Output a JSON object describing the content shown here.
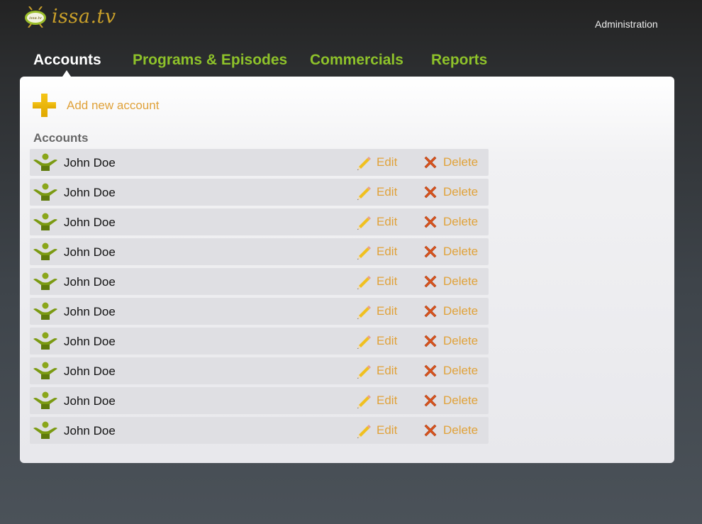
{
  "brand": {
    "name": "issa.tv",
    "badge": "issa.tv"
  },
  "header": {
    "admin_link": "Administration"
  },
  "nav": {
    "tabs": [
      {
        "label": "Accounts",
        "active": true
      },
      {
        "label": "Programs & Episodes",
        "active": false
      },
      {
        "label": "Commercials",
        "active": false
      },
      {
        "label": "Reports",
        "active": false
      }
    ]
  },
  "main": {
    "add_label": "Add new account",
    "section_title": "Accounts",
    "rows": [
      {
        "name": "John Doe",
        "edit": "Edit",
        "delete": "Delete"
      },
      {
        "name": "John Doe",
        "edit": "Edit",
        "delete": "Delete"
      },
      {
        "name": "John Doe",
        "edit": "Edit",
        "delete": "Delete"
      },
      {
        "name": "John Doe",
        "edit": "Edit",
        "delete": "Delete"
      },
      {
        "name": "John Doe",
        "edit": "Edit",
        "delete": "Delete"
      },
      {
        "name": "John Doe",
        "edit": "Edit",
        "delete": "Delete"
      },
      {
        "name": "John Doe",
        "edit": "Edit",
        "delete": "Delete"
      },
      {
        "name": "John Doe",
        "edit": "Edit",
        "delete": "Delete"
      },
      {
        "name": "John Doe",
        "edit": "Edit",
        "delete": "Delete"
      },
      {
        "name": "John Doe",
        "edit": "Edit",
        "delete": "Delete"
      }
    ]
  },
  "icons": {
    "logo": "tv-logo-icon",
    "add": "plus-icon",
    "user": "user-icon",
    "edit": "pencil-icon",
    "delete": "x-icon"
  },
  "colors": {
    "nav_tab": "#8ec22a",
    "nav_active": "#ffffff",
    "link": "#e0a23a",
    "row_bg": "#dfdfe3"
  }
}
